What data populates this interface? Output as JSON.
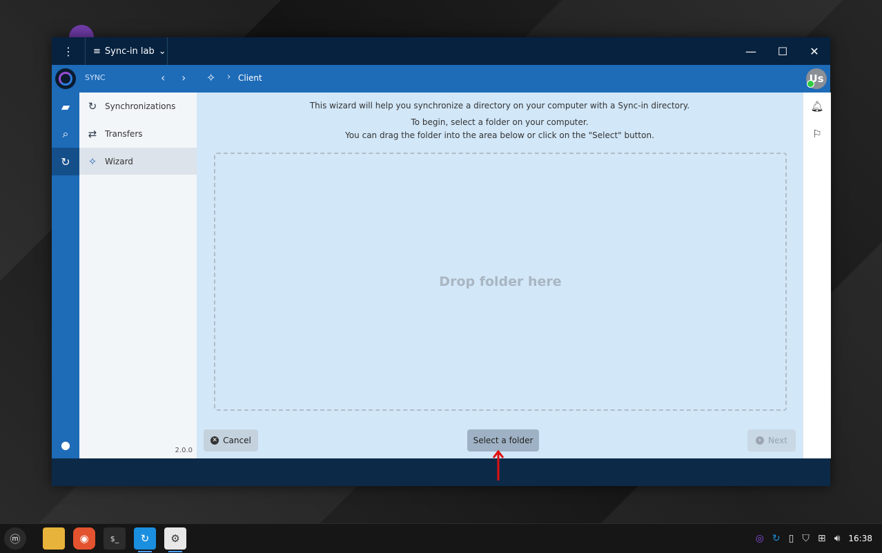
{
  "window": {
    "menu_icon": "⋮",
    "server_name": "Sync-in lab",
    "controls": {
      "minimize": "—",
      "maximize": "☐",
      "close": "✕"
    }
  },
  "appbar": {
    "section": "SYNC",
    "breadcrumb": "Client",
    "avatar_initials": "Us"
  },
  "sidebar": {
    "items": [
      {
        "label": "Synchronizations",
        "icon": "↻"
      },
      {
        "label": "Transfers",
        "icon": "⇄"
      },
      {
        "label": "Wizard",
        "icon": "✧"
      }
    ],
    "version": "2.0.0"
  },
  "rail": {
    "items": [
      "folder-icon",
      "search-icon",
      "sync-icon",
      "user-icon"
    ]
  },
  "main": {
    "intro_line1": "This wizard will help you synchronize a directory on your computer with a Sync-in directory.",
    "intro_line2": "To begin, select a folder on your computer.",
    "intro_line3": "You can drag the folder into the area below or click on the \"Select\" button.",
    "drop_text": "Drop folder here",
    "cancel_label": "Cancel",
    "select_label": "Select a folder",
    "next_label": "Next"
  },
  "taskbar": {
    "clock": "16:38"
  },
  "colors": {
    "appbar": "#1e6bb8",
    "titlebar": "#06223f",
    "main_bg": "#d2e7f8",
    "annotation_arrow": "#e01010"
  }
}
